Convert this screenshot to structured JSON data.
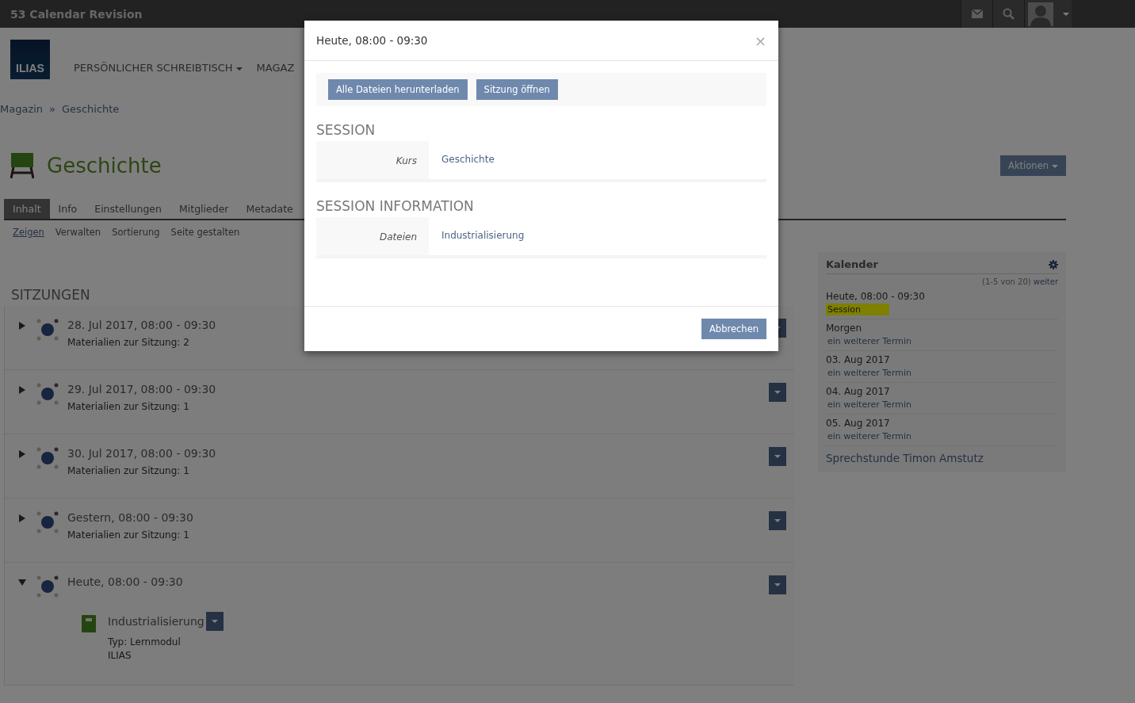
{
  "top_bar": {
    "title": "53 Calendar Revision"
  },
  "header": {
    "logo": "ILIAS",
    "nav": [
      {
        "label": "PERSÖNLICHER SCHREIBTISCH",
        "dropdown": true
      },
      {
        "label": "MAGAZ",
        "dropdown": false
      }
    ]
  },
  "breadcrumb": {
    "items": [
      "Magazin",
      "Geschichte"
    ],
    "separator": "»"
  },
  "page": {
    "title": "Geschichte",
    "actions_button": "Aktionen"
  },
  "tabs": [
    {
      "label": "Inhalt",
      "selected": true
    },
    {
      "label": "Info",
      "selected": false
    },
    {
      "label": "Einstellungen",
      "selected": false
    },
    {
      "label": "Mitglieder",
      "selected": false
    },
    {
      "label": "Metadate",
      "selected": false
    }
  ],
  "subtabs": [
    {
      "label": "Zeigen",
      "selected": true
    },
    {
      "label": "Verwalten",
      "selected": false
    },
    {
      "label": "Sortierung",
      "selected": false
    },
    {
      "label": "Seite gestalten",
      "selected": false
    }
  ],
  "sessions": {
    "heading": "SITZUNGEN",
    "items": [
      {
        "title": "28. Jul 2017, 08:00 - 09:30",
        "materials": "Materialien zur Sitzung: 2",
        "expanded": false
      },
      {
        "title": "29. Jul 2017, 08:00 - 09:30",
        "materials": "Materialien zur Sitzung: 1",
        "expanded": false
      },
      {
        "title": "30. Jul 2017, 08:00 - 09:30",
        "materials": "Materialien zur Sitzung: 1",
        "expanded": false
      },
      {
        "title": "Gestern, 08:00 - 09:30",
        "materials": "Materialien zur Sitzung: 1",
        "expanded": false
      },
      {
        "title": "Heute, 08:00 - 09:30",
        "expanded": true,
        "children": [
          {
            "title": "Industrialisierung",
            "type": "Typ: Lernmodul",
            "source": "ILIAS"
          }
        ]
      }
    ]
  },
  "calendar": {
    "title": "Kalender",
    "pager": "(1-5 von 20)",
    "next": "weiter",
    "entries": [
      {
        "date": "Heute, 08:00 - 09:30",
        "event": "Session",
        "highlighted": true
      },
      {
        "date": "Morgen",
        "event": "ein weiterer Termin",
        "highlighted": false
      },
      {
        "date": "03. Aug 2017",
        "event": "ein weiterer Termin",
        "highlighted": false
      },
      {
        "date": "04. Aug 2017",
        "event": "ein weiterer Termin",
        "highlighted": false
      },
      {
        "date": "05. Aug 2017",
        "event": "ein weiterer Termin",
        "highlighted": false
      }
    ],
    "footer": "Sprechstunde Timon Amstutz"
  },
  "modal": {
    "title": "Heute, 08:00 - 09:30",
    "close": "×",
    "buttons": [
      "Alle Dateien herunterladen",
      "Sitzung öffnen"
    ],
    "sections": [
      {
        "heading": "SESSION",
        "rows": [
          {
            "label": "Kurs",
            "value": "Geschichte"
          }
        ]
      },
      {
        "heading": "SESSION INFORMATION",
        "rows": [
          {
            "label": "Dateien",
            "value": "Industrialisierung"
          }
        ]
      }
    ],
    "cancel": "Abbrechen"
  }
}
